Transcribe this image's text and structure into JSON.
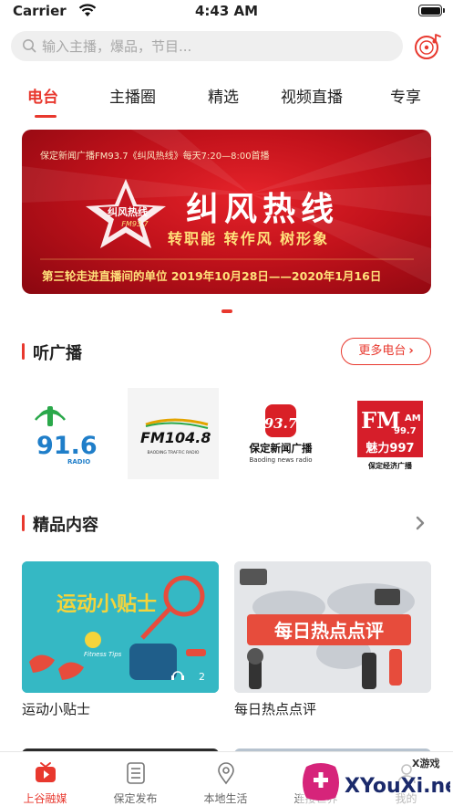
{
  "status_bar": {
    "carrier": "Carrier",
    "time": "4:43 AM"
  },
  "search": {
    "placeholder": "输入主播，爆品，节目..."
  },
  "tabs": [
    {
      "label": "电台",
      "active": true
    },
    {
      "label": "主播圈"
    },
    {
      "label": "精选"
    },
    {
      "label": "视频直播"
    },
    {
      "label": "专享"
    }
  ],
  "banner": {
    "top_line": "保定新闻广播FM93.7《纠风热线》每天7:20—8:00首播",
    "logo_text": "纠风热线",
    "logo_freq": "FM93.7",
    "title": "纠风热线",
    "slogan": "转职能  转作风  树形象",
    "bottom_line": "第三轮走进直播间的单位 2019年10月28日——2020年1月16日"
  },
  "radio_section": {
    "title": "听广播",
    "more_label": "更多电台",
    "stations": [
      {
        "main": "91.6",
        "sub": "RADIO"
      },
      {
        "main": "FM104.8",
        "sub": "BAODING TRAFFIC RADIO"
      },
      {
        "main": "93.7",
        "name": "保定新闻广播",
        "sub": "Baoding news radio"
      },
      {
        "main": "FM",
        "sub": "魅力997",
        "extra": "保定经济广播",
        "am": "AM",
        "freq": "99.7"
      }
    ]
  },
  "premium_section": {
    "title": "精品内容",
    "cards": [
      {
        "title": "运动小贴士",
        "art_text": "运动小贴士",
        "art_sub": "Fitness Tips",
        "count": "2"
      },
      {
        "title": "每日热点点评",
        "art_text": "每日热点点评"
      }
    ]
  },
  "tab_bar": [
    {
      "label": "上谷融媒",
      "active": true
    },
    {
      "label": "保定发布"
    },
    {
      "label": "本地生活"
    },
    {
      "label": "连接世界"
    },
    {
      "label": "我的"
    }
  ],
  "watermark": {
    "small": "X游戏",
    "big": "XYouXi.net"
  },
  "colors": {
    "accent": "#e8382e",
    "banner_red": "#c2121b",
    "card1_bg": "#35b8c4"
  }
}
